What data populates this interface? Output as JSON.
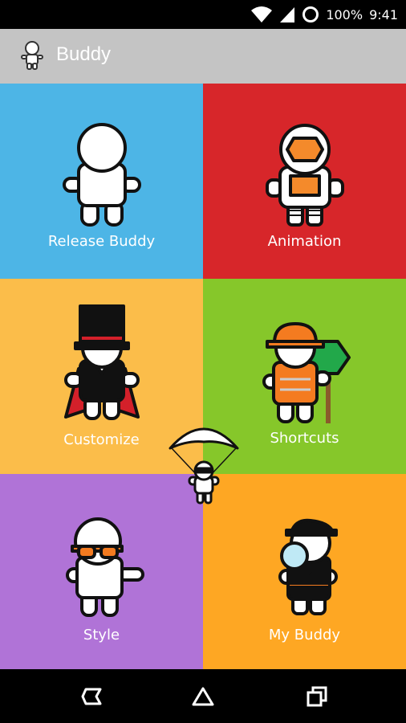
{
  "status_bar": {
    "battery_text": "100%",
    "time": "9:41",
    "icons": [
      "wifi-icon",
      "cell-signal-icon",
      "battery-icon"
    ]
  },
  "app_bar": {
    "title": "Buddy",
    "icon": "buddy-icon"
  },
  "tiles": [
    {
      "label": "Release Buddy",
      "color": "#4db5e6",
      "icon": "plain-buddy-icon"
    },
    {
      "label": "Animation",
      "color": "#d7262a",
      "icon": "astronaut-buddy-icon"
    },
    {
      "label": "Customize",
      "color": "#fbbd4a",
      "icon": "top-hat-buddy-icon"
    },
    {
      "label": "Shortcuts",
      "color": "#86c72a",
      "icon": "worker-buddy-icon"
    },
    {
      "label": "Style",
      "color": "#b073d7",
      "icon": "sunglasses-buddy-icon"
    },
    {
      "label": "My Buddy",
      "color": "#fea723",
      "icon": "detective-buddy-icon"
    }
  ],
  "nav_bar": {
    "buttons": [
      "back-icon",
      "home-icon",
      "recents-icon"
    ]
  }
}
